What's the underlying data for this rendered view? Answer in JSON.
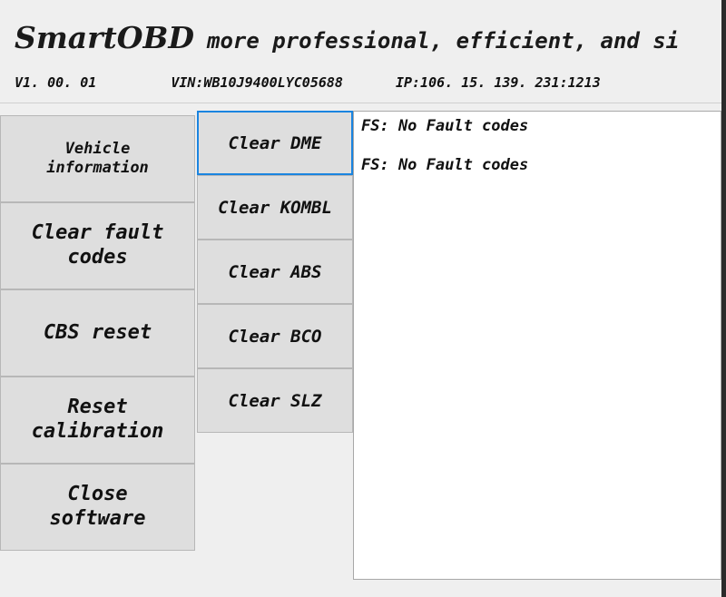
{
  "header": {
    "brand": "SmartOBD",
    "tagline": "more professional, efficient, and si",
    "version": "V1. 00. 01",
    "vin": "VIN:WB10J9400LYC05688",
    "ip": "IP:106. 15. 139. 231:1213"
  },
  "sidebar": {
    "items": [
      {
        "label": "Vehicle\ninformation",
        "size": "small"
      },
      {
        "label": "Clear fault\ncodes",
        "size": "normal"
      },
      {
        "label": "CBS reset",
        "size": "normal"
      },
      {
        "label": "Reset\ncalibration",
        "size": "normal"
      },
      {
        "label": "Close\nsoftware",
        "size": "normal"
      }
    ]
  },
  "tabs": {
    "selected_index": 0,
    "items": [
      {
        "label": "Clear DME"
      },
      {
        "label": "Clear KOMBL"
      },
      {
        "label": "Clear ABS"
      },
      {
        "label": "Clear BCO"
      },
      {
        "label": "Clear SLZ"
      }
    ]
  },
  "output": {
    "lines": [
      "FS: No Fault codes",
      "FS: No Fault codes"
    ]
  },
  "colors": {
    "page_background": "#efefef",
    "button_face": "#dedede",
    "button_border": "#b7b7b7",
    "focus_blue": "#1a84e0",
    "panel_background": "#ffffff",
    "text": "#111111"
  }
}
